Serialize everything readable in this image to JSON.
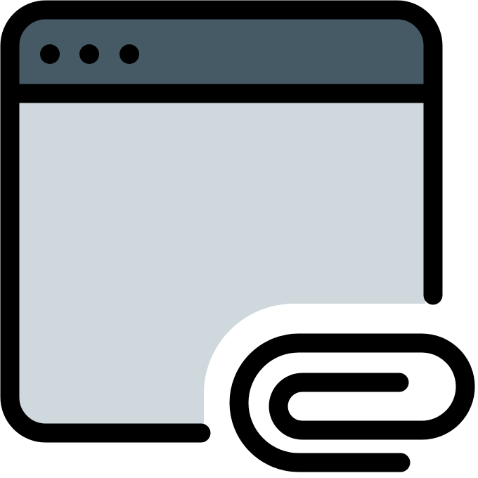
{
  "icon": {
    "name": "browser-window-attachment-icon",
    "window_icon": "browser-window-icon",
    "titlebar_dots_icon": "window-dots-icon",
    "attachment_icon": "paperclip-icon",
    "colors": {
      "outline": "#000000",
      "titlebar": "#455A64",
      "content": "#CFD8DC",
      "background": "#FFFFFF"
    }
  }
}
